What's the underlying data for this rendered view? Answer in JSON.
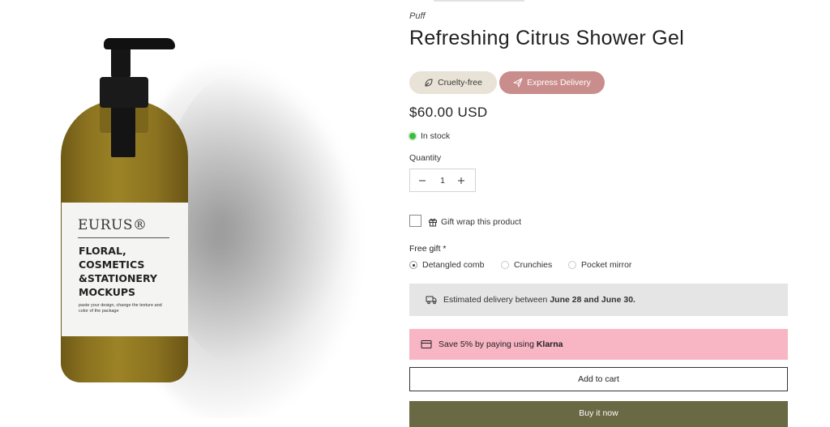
{
  "product_image": {
    "label_brand": "EURUS®",
    "label_title_lines": [
      "FLORAL,",
      "COSMETICS",
      "&STATIONERY",
      "MOCKUPS"
    ],
    "label_description": "paste your design, change the texture and color of the package"
  },
  "product": {
    "vendor": "Puff",
    "title": "Refreshing Citrus Shower Gel",
    "badges": [
      {
        "label": "Cruelty-free",
        "icon": "leaf-icon",
        "color": "#e9e2d6"
      },
      {
        "label": "Express Delivery",
        "icon": "send-icon",
        "color": "#c98d8b"
      }
    ],
    "price": "$60.00 USD",
    "stock": {
      "text": "In stock",
      "color": "#3dbb3d"
    },
    "quantity": {
      "label": "Quantity",
      "value": "1",
      "decrease_icon": "minus-icon",
      "increase_icon": "plus-icon"
    },
    "gift_wrap": {
      "label": "Gift wrap this product",
      "checked": false,
      "icon": "gift-icon"
    },
    "free_gift": {
      "label": "Free gift *",
      "options": [
        {
          "label": "Detangled comb",
          "selected": true
        },
        {
          "label": "Crunchies",
          "selected": false
        },
        {
          "label": "Pocket mirror",
          "selected": false
        }
      ]
    },
    "delivery": {
      "prefix": "Estimated delivery between",
      "dates": "June 28 and June 30.",
      "icon": "truck-icon"
    },
    "klarna": {
      "prefix": "Save 5% by paying using",
      "provider": "Klarna",
      "icon": "credit-card-icon",
      "color": "#f8b5c4"
    },
    "add_to_cart_label": "Add to cart",
    "buy_now_label": "Buy it now",
    "buy_now_color": "#696943"
  }
}
